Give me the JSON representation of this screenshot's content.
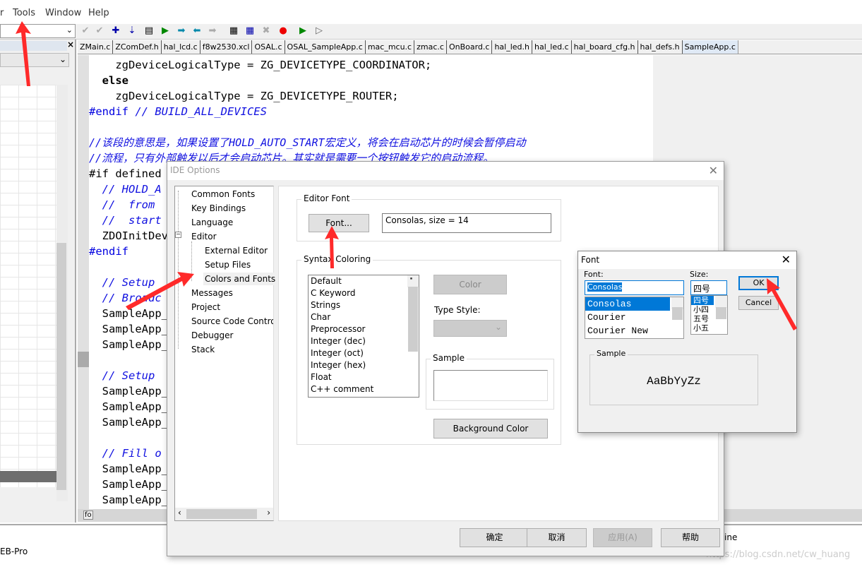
{
  "menu": [
    "r",
    "Tools",
    "Window",
    "Help"
  ],
  "tabs": [
    "ZMain.c",
    "ZComDef.h",
    "hal_lcd.c",
    "f8w2530.xcl",
    "OSAL.c",
    "OSAL_SampleApp.c",
    "mac_mcu.c",
    "zmac.c",
    "OnBoard.c",
    "hal_led.h",
    "hal_led.c",
    "hal_board_cfg.h",
    "hal_defs.h",
    "SampleApp.c"
  ],
  "code": {
    "l1": "    zgDeviceLogicalType = ZG_DEVICETYPE_COORDINATOR;",
    "l2": "  else",
    "l3": "    zgDeviceLogicalType = ZG_DEVICETYPE_ROUTER;",
    "l4a": "#endif",
    "l4b": " // BUILD_ALL_DEVICES",
    "l5": "//该段的意思是，如果设置了HOLD_AUTO_START宏定义，将会在启动芯片的时候会暂停启动",
    "l6": "//流程，只有外部触发以后才会启动芯片。其实就是需要一个按钮触发它的启动流程。",
    "l7": "#if defined",
    "l8": "  // HOLD_A",
    "l9": "  //  from",
    "l10": "  //  start",
    "l11": "  ZDOInitDev",
    "l12": "#endif",
    "l13": "  // Setup",
    "l14": "  // Broadc",
    "l15": "  SampleApp_",
    "l16": "  // Setup",
    "l17": "  // Fill o"
  },
  "status": {
    "left": "EB-Pro",
    "right": "ine",
    "watermark": "https://blog.csdn.net/cw_huang",
    "fo": "fo"
  },
  "ide": {
    "title": "IDE Options",
    "tree": [
      "Common Fonts",
      "Key Bindings",
      "Language",
      "Editor",
      "External Editor",
      "Setup Files",
      "Colors and Fonts",
      "Messages",
      "Project",
      "Source Code Contro",
      "Debugger",
      "Stack"
    ],
    "editor_font_label": "Editor Font",
    "font_button": "Font...",
    "font_value": "Consolas, size = 14",
    "syntax_label": "Syntax Coloring",
    "syntax_items": [
      "Default",
      "C Keyword",
      "Strings",
      "Char",
      "Preprocessor",
      "Integer (dec)",
      "Integer (oct)",
      "Integer (hex)",
      "Float",
      "C++ comment"
    ],
    "color_button": "Color",
    "type_style_label": "Type Style:",
    "sample_label": "Sample",
    "bg_color_button": "Background Color",
    "ok": "确定",
    "cancel": "取消",
    "apply": "应用(A)",
    "help": "帮助"
  },
  "font_dialog": {
    "title": "Font",
    "font_label": "Font:",
    "font_value": "Consolas",
    "fonts": [
      "Consolas",
      "Courier",
      "Courier New"
    ],
    "size_label": "Size:",
    "size_value": "四号",
    "sizes": [
      "四号",
      "小四",
      "五号",
      "小五"
    ],
    "ok": "OK",
    "cancel": "Cancel",
    "sample_label": "Sample",
    "sample_text": "AaBbYyZz"
  },
  "colors": {
    "selection": "#0078d7",
    "annotation": "#ff2020"
  }
}
